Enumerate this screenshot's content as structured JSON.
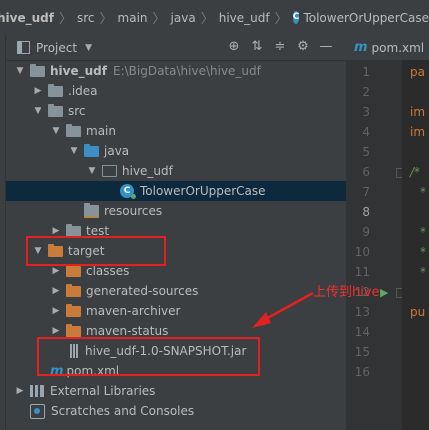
{
  "breadcrumb": {
    "project": "hive_udf",
    "items": [
      "src",
      "main",
      "java",
      "hive_udf"
    ],
    "class_name": "TolowerOrUpperCase"
  },
  "project_panel": {
    "title": "Project",
    "tools": [
      "locate-icon",
      "collapse-all-icon",
      "expand-icon",
      "settings-icon",
      "hide-icon"
    ]
  },
  "tree": {
    "root_label": "hive_udf",
    "root_path": "E:\\BigData\\hive\\hive_udf",
    "idea": ".idea",
    "src": "src",
    "main": "main",
    "java": "java",
    "pkg": "hive_udf",
    "class_file": "TolowerOrUpperCase",
    "resources": "resources",
    "test": "test",
    "target": "target",
    "classes": "classes",
    "generated_sources": "generated-sources",
    "maven_archiver": "maven-archiver",
    "maven_status": "maven-status",
    "jar": "hive_udf-1.0-SNAPSHOT.jar",
    "pom": "pom.xml",
    "external_libraries": "External Libraries",
    "scratches": "Scratches and Consoles"
  },
  "editor": {
    "tab_label": "pom.xml",
    "line_numbers": [
      "1",
      "2",
      "3",
      "4",
      "5",
      "6",
      "7",
      "8",
      "9",
      "10",
      "11",
      "12",
      "13",
      "14",
      "15",
      "16"
    ],
    "active_line": "8",
    "code": {
      "line1": "pa",
      "line3": "im",
      "line4": "im",
      "line6": "/*",
      "line7": "*",
      "line9": "*",
      "line10": "*",
      "line11": "*",
      "line12": "pu"
    }
  },
  "annotation": {
    "text": "上传到hive"
  },
  "colors": {
    "annotation_red": "#e42020",
    "selection": "#0d293e",
    "accent_blue": "#3592c4"
  }
}
